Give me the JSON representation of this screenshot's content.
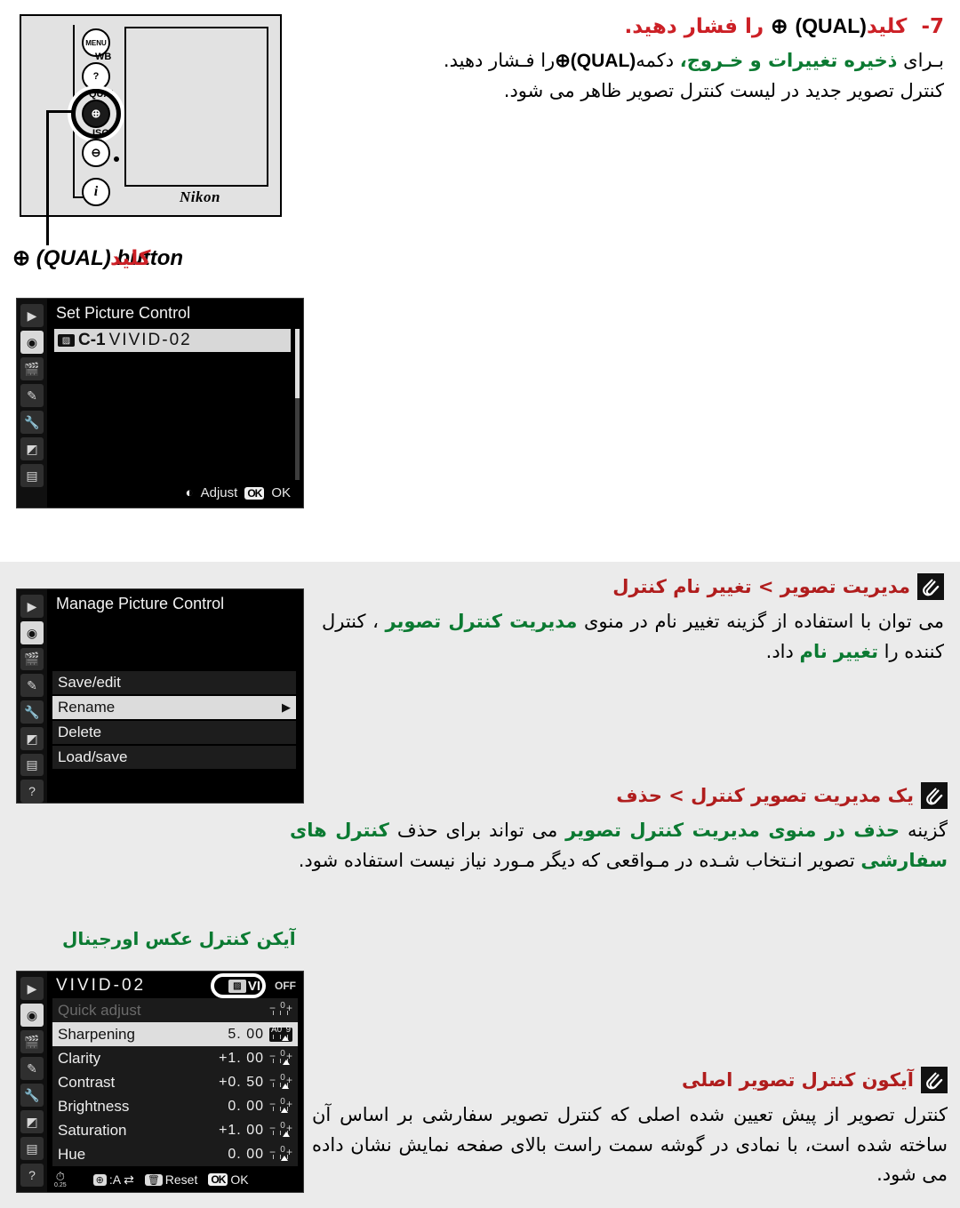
{
  "page": {
    "background": "#ffffff",
    "band_color": "#ebebeb",
    "accent_red": "#cc2026",
    "accent_dark_red": "#b01d1d",
    "accent_green": "#0b7a32"
  },
  "step": {
    "number": "7-",
    "heading_pre": "کلید",
    "heading_paren_open": "(",
    "heading_qual": "QUAL",
    "heading_paren_close": ")",
    "heading_glyph": "⊕",
    "heading_post": "را فشار دهید.",
    "body_line1_a": "بـرای ",
    "body_line1_green": "ذخیره تغییرات و خـروج،",
    "body_line1_b": " دکمه",
    "body_line1_qual": "(QUAL)",
    "body_line1_c": "را فـشار دهید.",
    "body_line2": "کنترل تصویر جدید در لیست کنترل تصویر ظاهر می شود."
  },
  "camera": {
    "brand": "Nikon",
    "buttons": [
      {
        "name": "menu-button",
        "label": "MENU"
      },
      {
        "name": "wb-button",
        "label": "WB"
      },
      {
        "name": "qual-button",
        "label": "QUAL"
      },
      {
        "name": "iso-button",
        "label": "ISO"
      },
      {
        "name": "zoom-out-button",
        "label": "⊖"
      },
      {
        "name": "info-button",
        "label": "i"
      }
    ],
    "caption_glyph": "⊕",
    "caption_text": "(QUAL) button",
    "caption_overlay_fa": "کلید"
  },
  "lcd_set_picture_control": {
    "title": "Set Picture Control",
    "item_badge": "C-1",
    "item_label": "VIVID-02",
    "footer_adjust": "Adjust",
    "footer_ok_badge": "OK",
    "footer_ok_label": "OK",
    "rail_icons": [
      "playback-icon",
      "camera-icon",
      "movie-icon",
      "pencil-icon",
      "wrench-icon",
      "retouch-icon",
      "mymenu-icon"
    ]
  },
  "lcd_manage_picture_control": {
    "title": "Manage Picture Control",
    "items": [
      {
        "label": "Save/edit",
        "selected": false,
        "submenu": false
      },
      {
        "label": "Rename",
        "selected": true,
        "submenu": true
      },
      {
        "label": "Delete",
        "selected": false,
        "submenu": false
      },
      {
        "label": "Load/save",
        "selected": false,
        "submenu": false
      }
    ],
    "rail_icons": [
      "playback-icon",
      "camera-icon",
      "movie-icon",
      "pencil-icon",
      "wrench-icon",
      "retouch-icon",
      "mymenu-icon",
      "help-icon"
    ]
  },
  "lcd_vivid": {
    "title": "VIVID-02",
    "corner_badge": "VI",
    "corner_off": "OFF",
    "rows": [
      {
        "name": "Quick adjust",
        "value": "",
        "selected": false,
        "dimmed": true,
        "marker_pct": 50
      },
      {
        "name": "Sharpening",
        "value": "5. 00",
        "selected": true,
        "dimmed": false,
        "marker_pct": 55,
        "scale": "A0-9"
      },
      {
        "name": "Clarity",
        "value": "+1. 00",
        "selected": false,
        "dimmed": false,
        "marker_pct": 58
      },
      {
        "name": "Contrast",
        "value": "+0. 50",
        "selected": false,
        "dimmed": false,
        "marker_pct": 54
      },
      {
        "name": "Brightness",
        "value": "0. 00",
        "selected": false,
        "dimmed": false,
        "marker_pct": 50
      },
      {
        "name": "Saturation",
        "value": "+1. 00",
        "selected": false,
        "dimmed": false,
        "marker_pct": 58
      },
      {
        "name": "Hue",
        "value": "0. 00",
        "selected": false,
        "dimmed": false,
        "marker_pct": 50
      }
    ],
    "footer_timer": "0.25",
    "footer_grid": ":A",
    "footer_reset": "Reset",
    "footer_ok_badge": "OK",
    "footer_ok_label": "OK",
    "rail_icons": [
      "playback-icon",
      "camera-icon",
      "movie-icon",
      "pencil-icon",
      "wrench-icon",
      "retouch-icon",
      "mymenu-icon",
      "help-icon"
    ]
  },
  "green_label_original_icon": "آیکن کنترل عکس اورجینال",
  "notes": [
    {
      "id": "rename",
      "heading": "مدیریت تصویر > تغییر نام کنترل",
      "body_a": "می توان با استفاده از گزینه تغییر نام در منوی ",
      "body_green1": "مدیریت کنترل تصویر",
      "body_b": " ، کنترل کننده را ",
      "body_green2": "تغییر نام",
      "body_c": " داد."
    },
    {
      "id": "delete",
      "heading": "یک مدیریت تصویر کنترل > حذف",
      "body_a": "گزینه ",
      "body_green1": "حذف در منوی مدیریت کنترل تصویر",
      "body_b": " می تواند برای حذف ",
      "body_green2": "کنترل های سفارشی",
      "body_c": " تصویر انـتخاب شـده در مـواقعی که دیگر مـورد نیاز نیست استفاده شود."
    },
    {
      "id": "original-icon",
      "heading": "آیکون کنترل تصویر اصلی",
      "body_full": "کنترل تصویر از پیش تعیین شده اصلی که کنترل تصویر سفارشی بر اساس آن ساخته شده  است، با نمادی در گوشه سمت راست بالای صفحه نمایش نشان داده می شود."
    }
  ]
}
